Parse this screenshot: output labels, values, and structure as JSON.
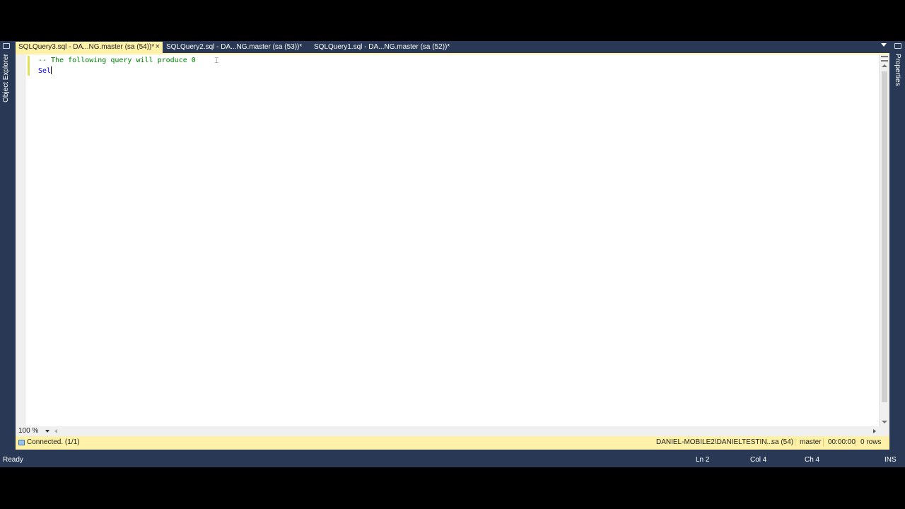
{
  "tabs": [
    {
      "label": "SQLQuery3.sql - DA...NG.master (sa (54))*",
      "active": true
    },
    {
      "label": "SQLQuery2.sql - DA...NG.master (sa (53))*",
      "active": false
    },
    {
      "label": "SQLQuery1.sql - DA...NG.master (sa (52))*",
      "active": false
    }
  ],
  "tab_close_glyph": "×",
  "side_panels": {
    "left": "Object Explorer",
    "right": "Properties"
  },
  "editor": {
    "lines": [
      "-- The following query will produce 0",
      "Sel"
    ]
  },
  "zoom": {
    "value": "100 %"
  },
  "query_status": {
    "connection": "Connected. (1/1)",
    "server": "DANIEL-MOBILE2\\DANIELTESTIN...",
    "user": "sa (54)",
    "database": "master",
    "elapsed": "00:00:00",
    "rows": "0 rows"
  },
  "status_bar": {
    "state": "Ready",
    "line": "Ln 2",
    "col": "Col 4",
    "ch": "Ch 4",
    "mode": "INS"
  },
  "colors": {
    "chrome": "#293955",
    "active_tab": "#fff1a8",
    "comment": "#008000",
    "keyword": "#0000ff"
  }
}
